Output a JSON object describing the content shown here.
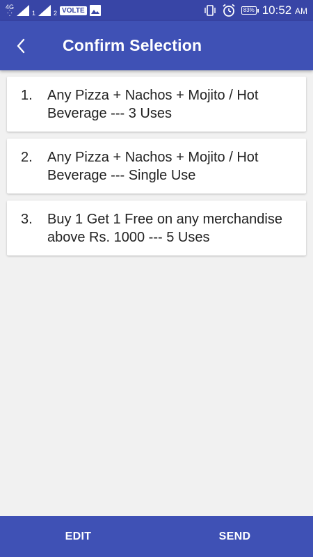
{
  "status_bar": {
    "network_left": "4G",
    "sim1": "1",
    "sim2": "2",
    "volte": "VOLTE",
    "battery": "83%",
    "time": "10:52",
    "ampm": "AM",
    "icons": [
      "signal-icon",
      "image-icon",
      "vibrate-icon",
      "alarm-icon",
      "battery-icon"
    ]
  },
  "app_bar": {
    "title": "Confirm Selection",
    "back_icon": "chevron-left-icon"
  },
  "items": [
    {
      "number": "1.",
      "text": "Any Pizza + Nachos + Mojito / Hot Beverage --- 3 Uses"
    },
    {
      "number": "2.",
      "text": "Any Pizza + Nachos + Mojito / Hot Beverage --- Single Use"
    },
    {
      "number": "3.",
      "text": "Buy 1 Get 1 Free on any merchandise above Rs. 1000 --- 5 Uses"
    }
  ],
  "bottom_bar": {
    "edit_label": "EDIT",
    "send_label": "SEND"
  },
  "colors": {
    "primary": "#3f51b5",
    "status_bar": "#3845a6",
    "background": "#f1f1f1"
  }
}
